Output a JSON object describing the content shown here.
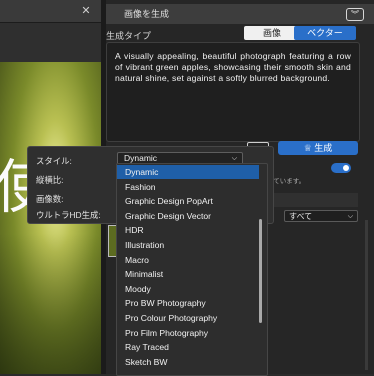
{
  "panel": {
    "title": "画像を生成",
    "type_label": "生成タイプ",
    "tab_image": "画像",
    "tab_vector": "ベクター",
    "prompt": "A visually appealing, beautiful photograph featuring a row of vibrant green apples, showcasing their smooth skin and natural shine, set against a softly blurred background.",
    "more_label": "•••",
    "generate_label": "♕ 生成",
    "partial_note": "しています。",
    "filter_value": "すべて"
  },
  "left": {
    "close_label": "✕",
    "canvas_glyph": "使"
  },
  "settings": {
    "style_label": "スタイル:",
    "ratio_label": "縦横比:",
    "count_label": "画像数:",
    "uhd_label": "ウルトラHD生成:",
    "style_value": "Dynamic"
  },
  "dropdown": {
    "options": [
      "Dynamic",
      "Fashion",
      "Graphic Design PopArt",
      "Graphic Design Vector",
      "HDR",
      "Illustration",
      "Macro",
      "Minimalist",
      "Moody",
      "Pro BW Photography",
      "Pro Colour Photography",
      "Pro Film Photography",
      "Ray Traced",
      "Sketch BW"
    ],
    "selected_index": 0
  },
  "colors": {
    "accent": "#2a6fc9",
    "selected": "#1f5fa8"
  }
}
